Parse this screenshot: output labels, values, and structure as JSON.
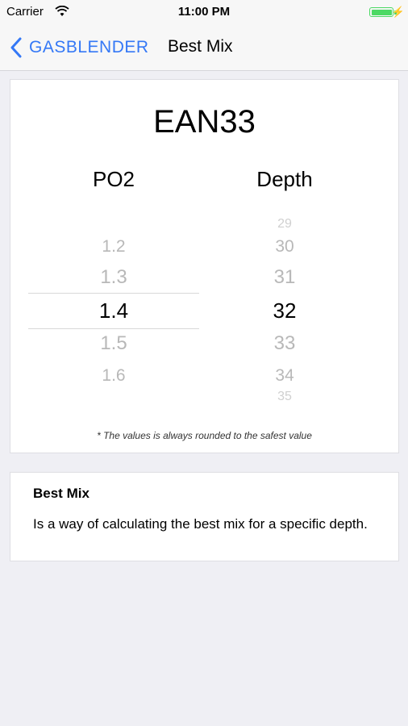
{
  "status_bar": {
    "carrier": "Carrier",
    "time": "11:00 PM",
    "battery_level": 1.0,
    "battery_color": "#4cd964",
    "charging_icon": "bolt-icon"
  },
  "nav": {
    "back_label": "GASBLENDER",
    "back_icon": "chevron-left-icon",
    "title": "Best Mix",
    "accent_color": "#3478f6"
  },
  "result": {
    "mix": "EAN33",
    "po2_label": "PO2",
    "depth_label": "Depth",
    "po2_options": [
      "1.2",
      "1.3",
      "1.4",
      "1.5",
      "1.6"
    ],
    "po2_selected": "1.4",
    "depth_options": [
      "29",
      "30",
      "31",
      "32",
      "33",
      "34",
      "35"
    ],
    "depth_selected": "32",
    "footnote": "* The values is always rounded to the safest value"
  },
  "info": {
    "title": "Best Mix",
    "text": "Is a way of calculating the best mix for a specific depth."
  }
}
